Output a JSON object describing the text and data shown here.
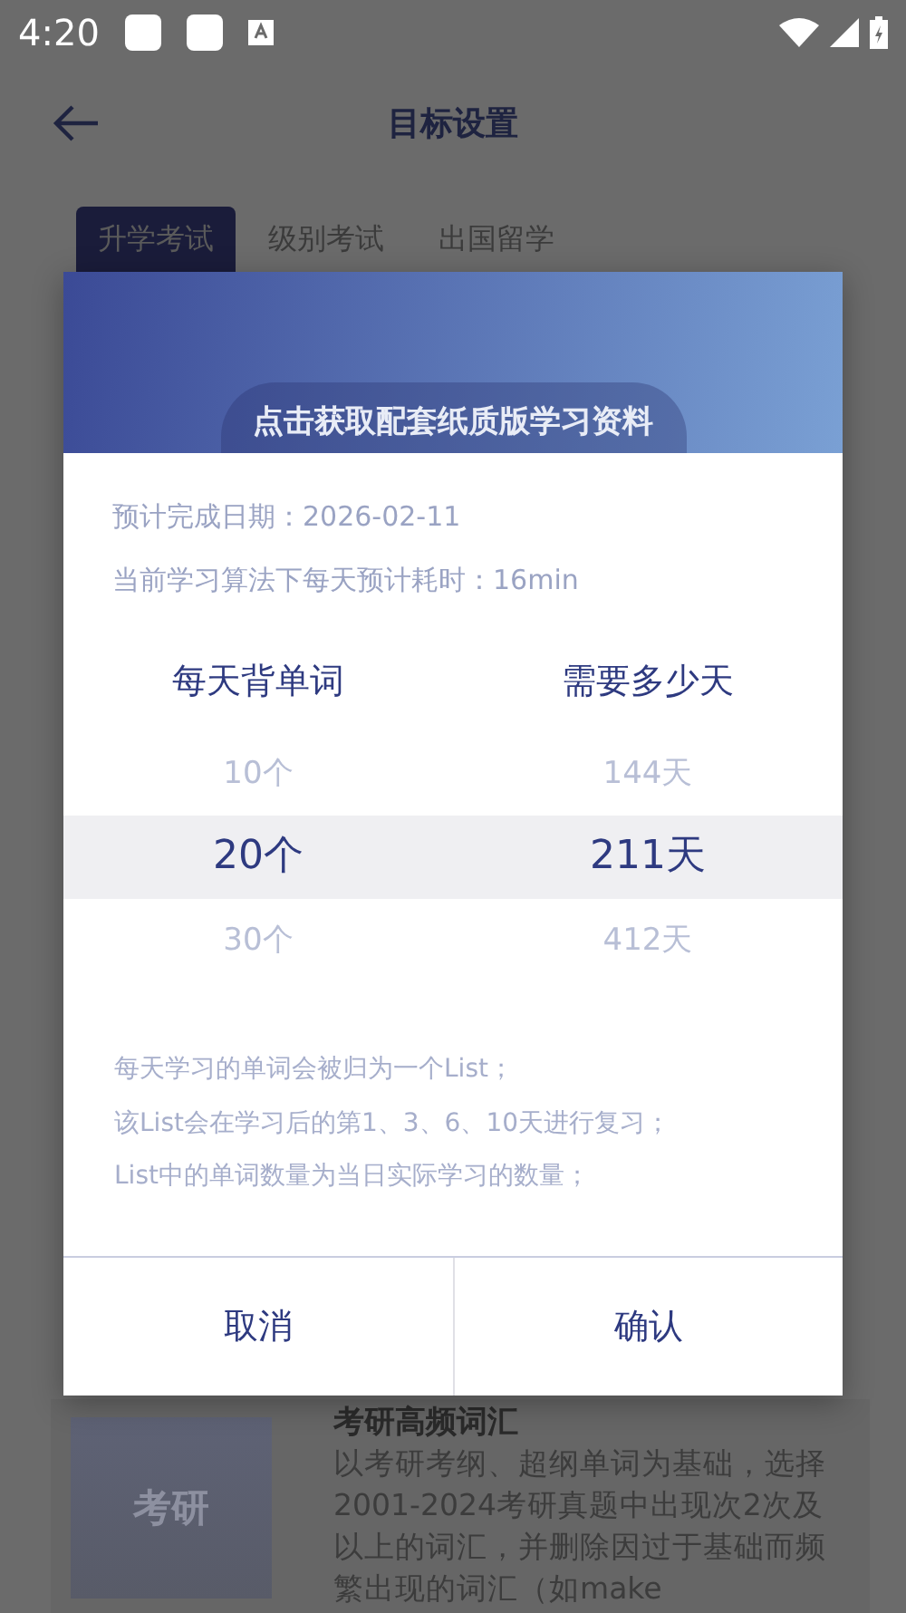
{
  "status_bar": {
    "time": "4:20"
  },
  "header": {
    "title": "目标设置"
  },
  "tabs": [
    {
      "label": "升学考试",
      "selected": true
    },
    {
      "label": "级别考试",
      "selected": false
    },
    {
      "label": "出国留学",
      "selected": false
    }
  ],
  "background_card": {
    "thumbnail": "考研",
    "title": "考研高频词汇",
    "description": "以考研考纲、超纲单词为基础，选择2001-2024考研真题中出现次2次及以上的词汇，并删除因过于基础而频繁出现的词汇（如make"
  },
  "dialog": {
    "banner_button": "点击获取配套纸质版学习资料",
    "info": [
      "预计完成日期：2026-02-11",
      "当前学习算法下每天预计耗时：16min"
    ],
    "pickers": [
      {
        "title": "每天背单词",
        "options": [
          {
            "label": "10个",
            "selected": false
          },
          {
            "label": "20个",
            "selected": true
          },
          {
            "label": "30个",
            "selected": false
          }
        ]
      },
      {
        "title": "需要多少天",
        "options": [
          {
            "label": "144天",
            "selected": false
          },
          {
            "label": "211天",
            "selected": true
          },
          {
            "label": "412天",
            "selected": false
          }
        ]
      }
    ],
    "notes": [
      "每天学习的单词会被归为一个List；",
      "该List会在学习后的第1、3、6、10天进行复习；",
      "List中的单词数量为当日实际学习的数量；"
    ],
    "buttons": [
      "取消",
      "确认"
    ]
  }
}
